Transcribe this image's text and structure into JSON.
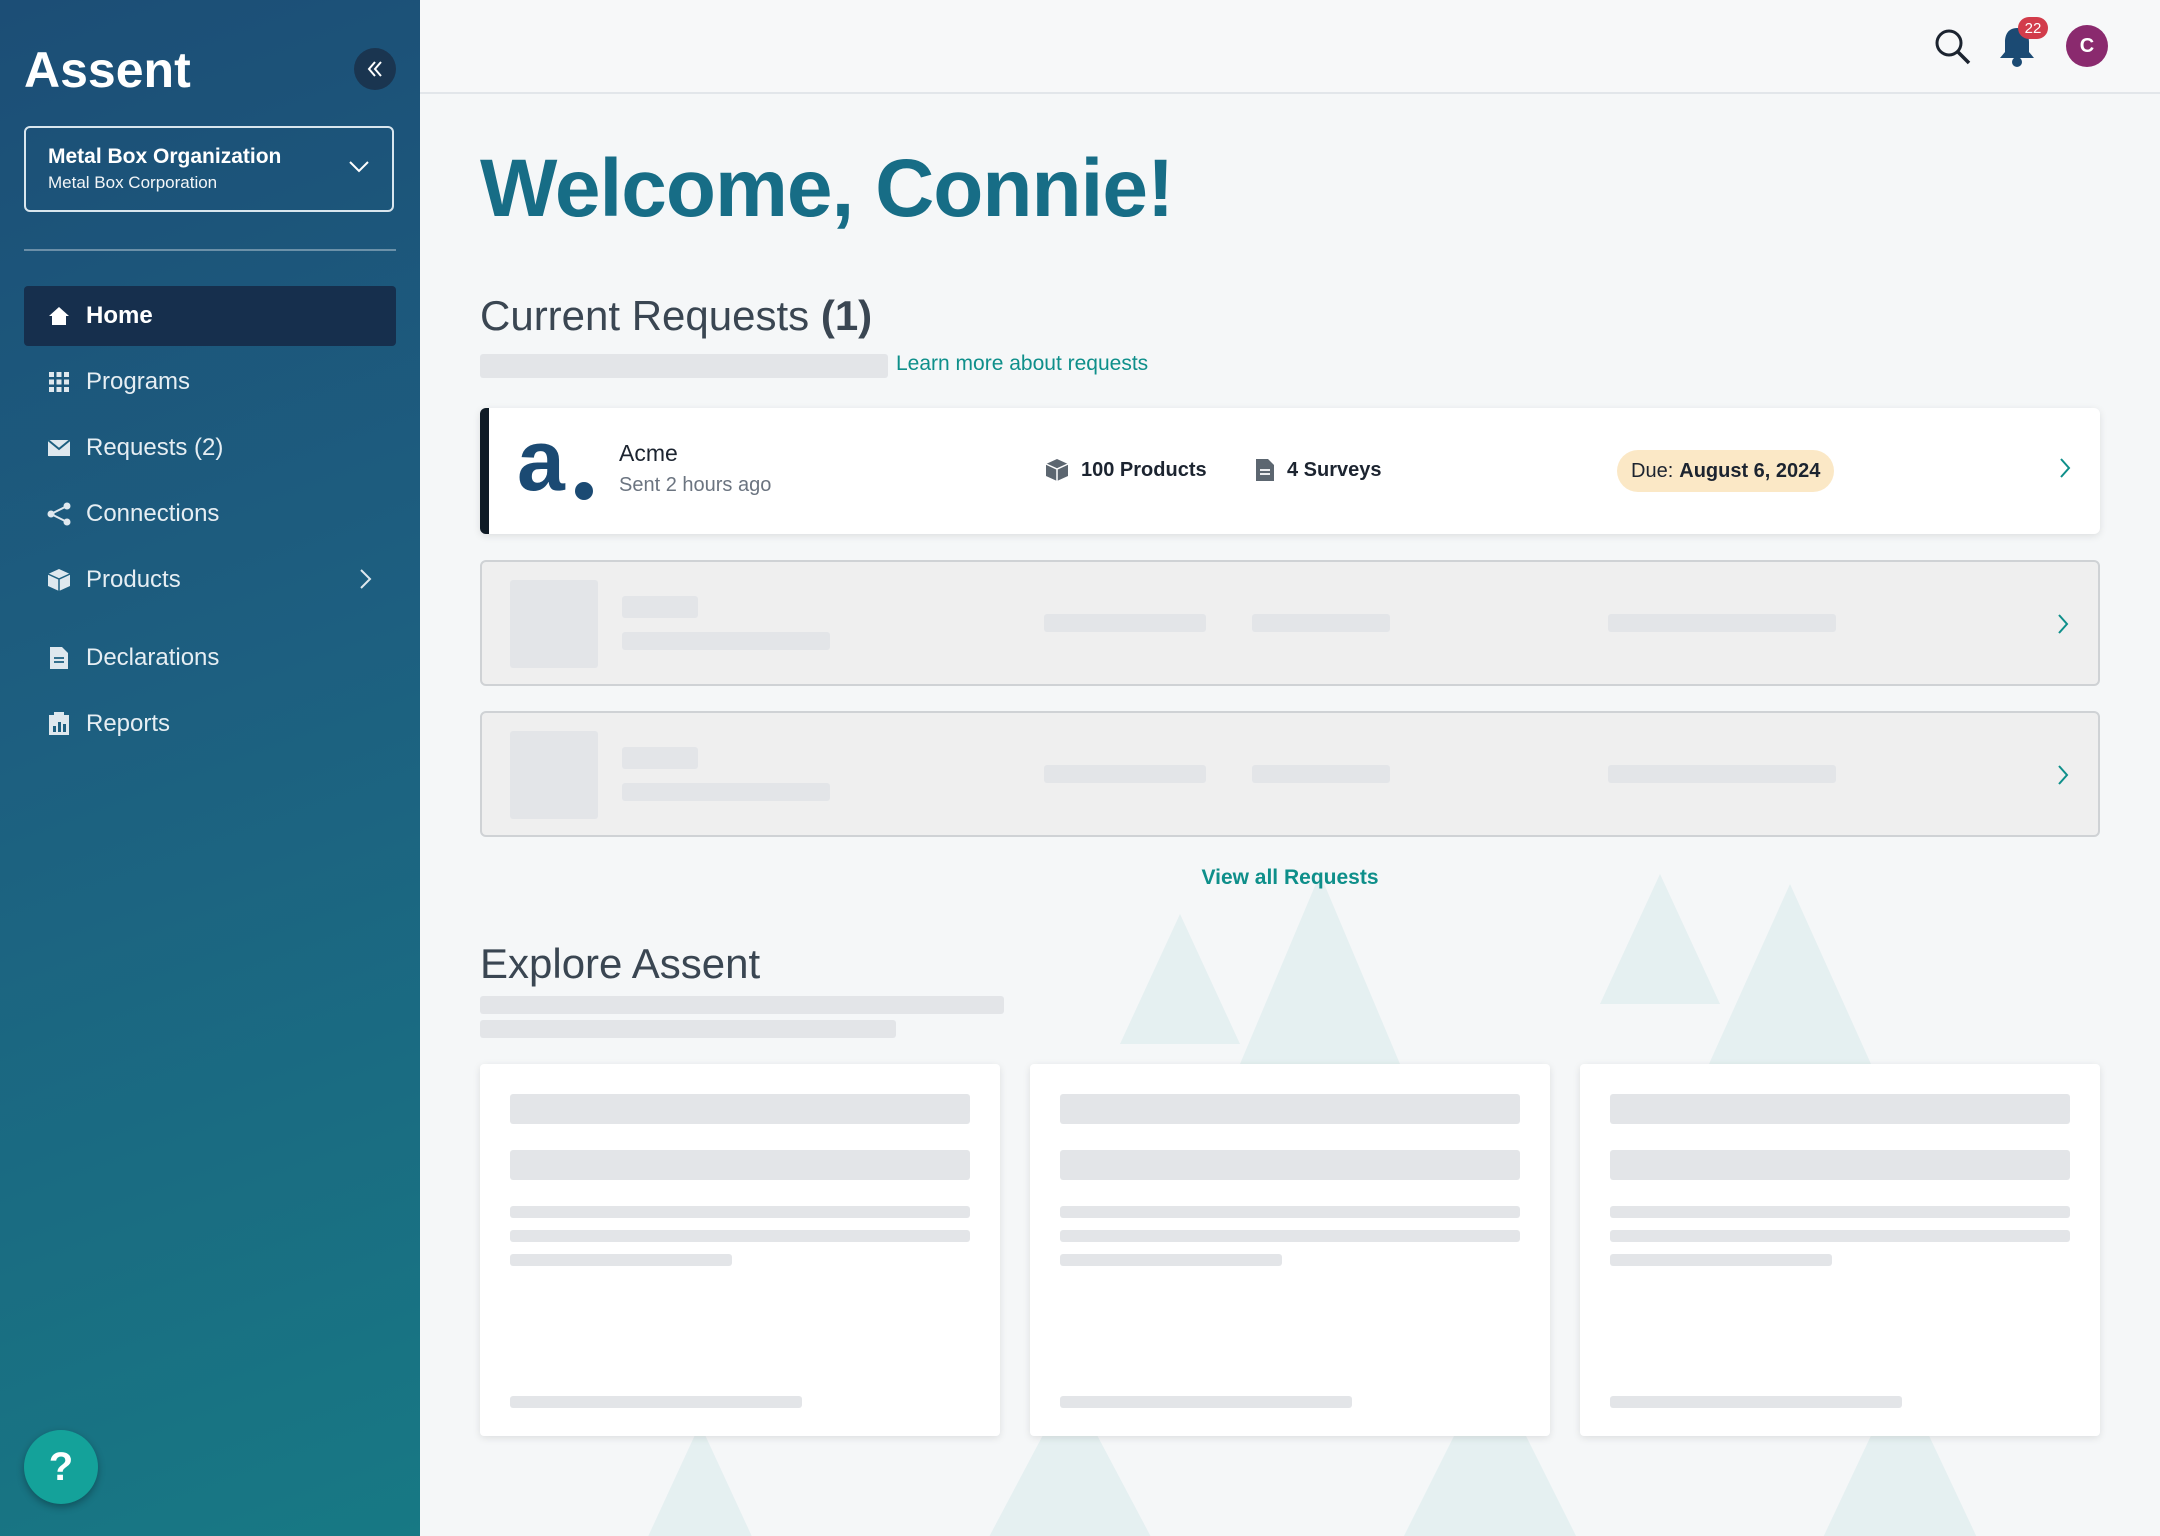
{
  "sidebar": {
    "logo_text": "Assent",
    "org": {
      "name": "Metal Box Organization",
      "subtitle": "Metal Box Corporation"
    },
    "nav": [
      {
        "label": "Home",
        "icon": "home-icon",
        "active": true
      },
      {
        "label": "Programs",
        "icon": "grid-icon"
      },
      {
        "label": "Requests (2)",
        "icon": "envelope-icon"
      },
      {
        "label": "Connections",
        "icon": "share-icon"
      },
      {
        "label": "Products",
        "icon": "box-icon",
        "has_submenu": true
      },
      {
        "label": "Declarations",
        "icon": "document-icon"
      },
      {
        "label": "Reports",
        "icon": "clipboard-chart-icon"
      }
    ],
    "help_label": "?"
  },
  "topbar": {
    "notification_count": "22",
    "avatar_initial": "C"
  },
  "main": {
    "welcome": "Welcome, Connie!",
    "current_requests": {
      "title": "Current Requests",
      "count": "(1)",
      "learn_more": "Learn more about requests",
      "request": {
        "logo_letter": "a",
        "name": "Acme",
        "sent": "Sent 2 hours ago",
        "products": "100 Products",
        "surveys": "4 Surveys",
        "due_label": "Due:",
        "due_date": "August 6, 2024"
      },
      "view_all": "View all Requests"
    },
    "explore": {
      "title": "Explore Assent"
    }
  },
  "colors": {
    "sidebar_top": "#1c4e76",
    "sidebar_bottom": "#177984",
    "active_nav": "#162f4d",
    "accent_teal": "#0e8f8a",
    "welcome_text": "#176d86",
    "badge_red": "#d23c4b",
    "avatar": "#8a2a6e",
    "due_badge": "#fbe8c6"
  }
}
